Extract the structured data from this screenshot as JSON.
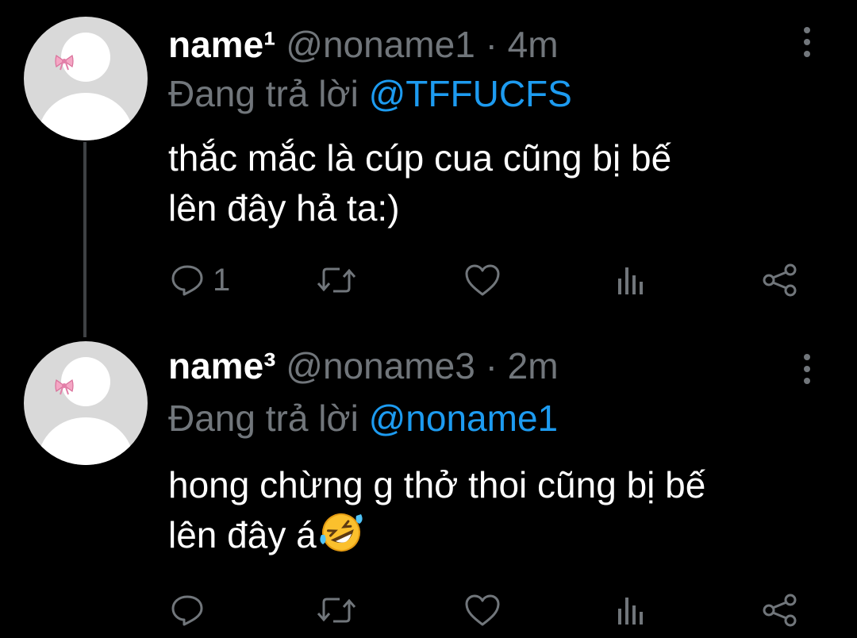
{
  "tweets": [
    {
      "name": "name¹",
      "handle": "@noname1",
      "separator": "·",
      "time": "4m",
      "reply_prefix": "Đang trả lời",
      "reply_to": "@TFFUCFS",
      "text_lines": [
        "thắc mắc là cúp cua cũng bị bế",
        "lên đây hả ta:)"
      ],
      "reply_count": "1",
      "emoji": "",
      "icons": [
        "more-vertical-icon",
        "reply-icon",
        "retweet-icon",
        "like-icon",
        "views-icon",
        "share-icon"
      ]
    },
    {
      "name": "name³",
      "handle": "@noname3",
      "separator": "·",
      "time": "2m",
      "reply_prefix": "Đang trả lời",
      "reply_to": "@noname1",
      "text_lines": [
        "hong chừng g thở thoi cũng bị bế",
        "lên đây á"
      ],
      "reply_count": "",
      "emoji": "rolling-on-floor-laughing-icon",
      "icons": [
        "more-vertical-icon",
        "reply-icon",
        "retweet-icon",
        "like-icon",
        "views-icon",
        "share-icon"
      ]
    }
  ],
  "colors": {
    "background": "#000000",
    "text": "#ffffff",
    "secondary": "#71767b",
    "mention": "#1d9bf0",
    "thread_line": "#3e4144",
    "avatar_bg": "#d9d9d9"
  }
}
